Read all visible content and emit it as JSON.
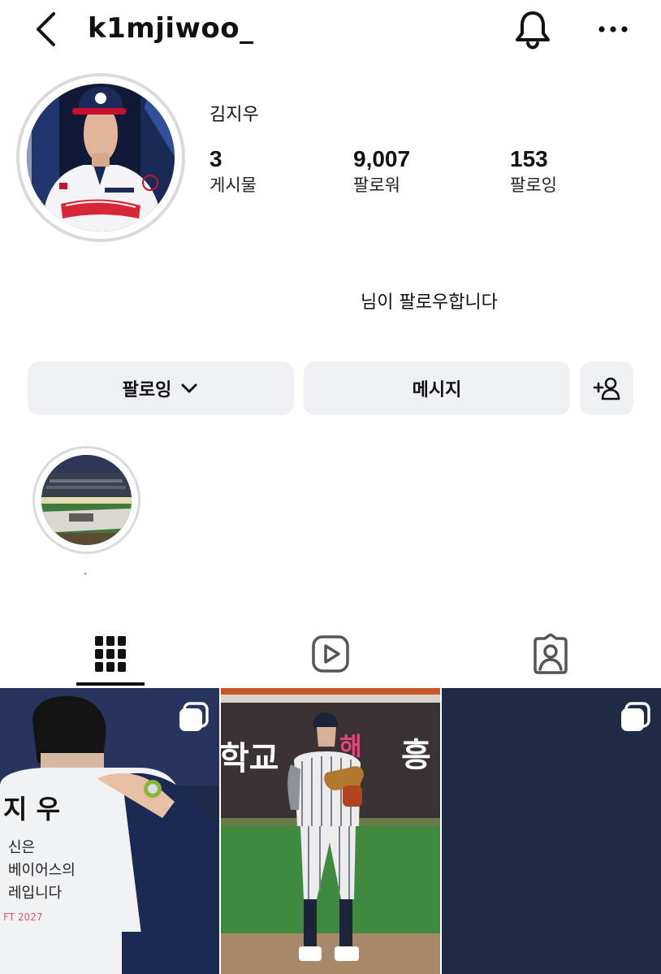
{
  "header": {
    "username": "k1mjiwoo_",
    "back_icon": "chevron-left-icon",
    "bell_icon": "bell-icon",
    "more_icon": "more-horizontal-icon"
  },
  "profile": {
    "full_name": "김지우",
    "avatar_icon": "profile-photo",
    "stats": [
      {
        "value": "3",
        "label": "게시물"
      },
      {
        "value": "9,007",
        "label": "팔로워"
      },
      {
        "value": "153",
        "label": "팔로잉"
      }
    ],
    "mutual_text": "님이 팔로우합니다"
  },
  "actions": {
    "following_label": "팔로잉",
    "message_label": "메시지",
    "add_user_icon": "add-user-icon"
  },
  "highlights": [
    {
      "label": "."
    }
  ],
  "tabs": [
    {
      "icon": "grid-icon",
      "active": true
    },
    {
      "icon": "reels-icon",
      "active": false
    },
    {
      "icon": "tagged-icon",
      "active": false
    }
  ],
  "posts": [
    {
      "kind": "carousel",
      "caption_text": [
        "지 우",
        "신은",
        "베이어스의",
        "레입니다",
        "FT 2027"
      ]
    },
    {
      "kind": "single",
      "caption_text": [
        "학교",
        "해",
        "흥"
      ]
    },
    {
      "kind": "carousel",
      "caption_text": []
    }
  ],
  "colors": {
    "button_bg": "#eef0f3",
    "ring": "#d9dadd",
    "text": "#111111",
    "navy": "#1f2a44"
  }
}
